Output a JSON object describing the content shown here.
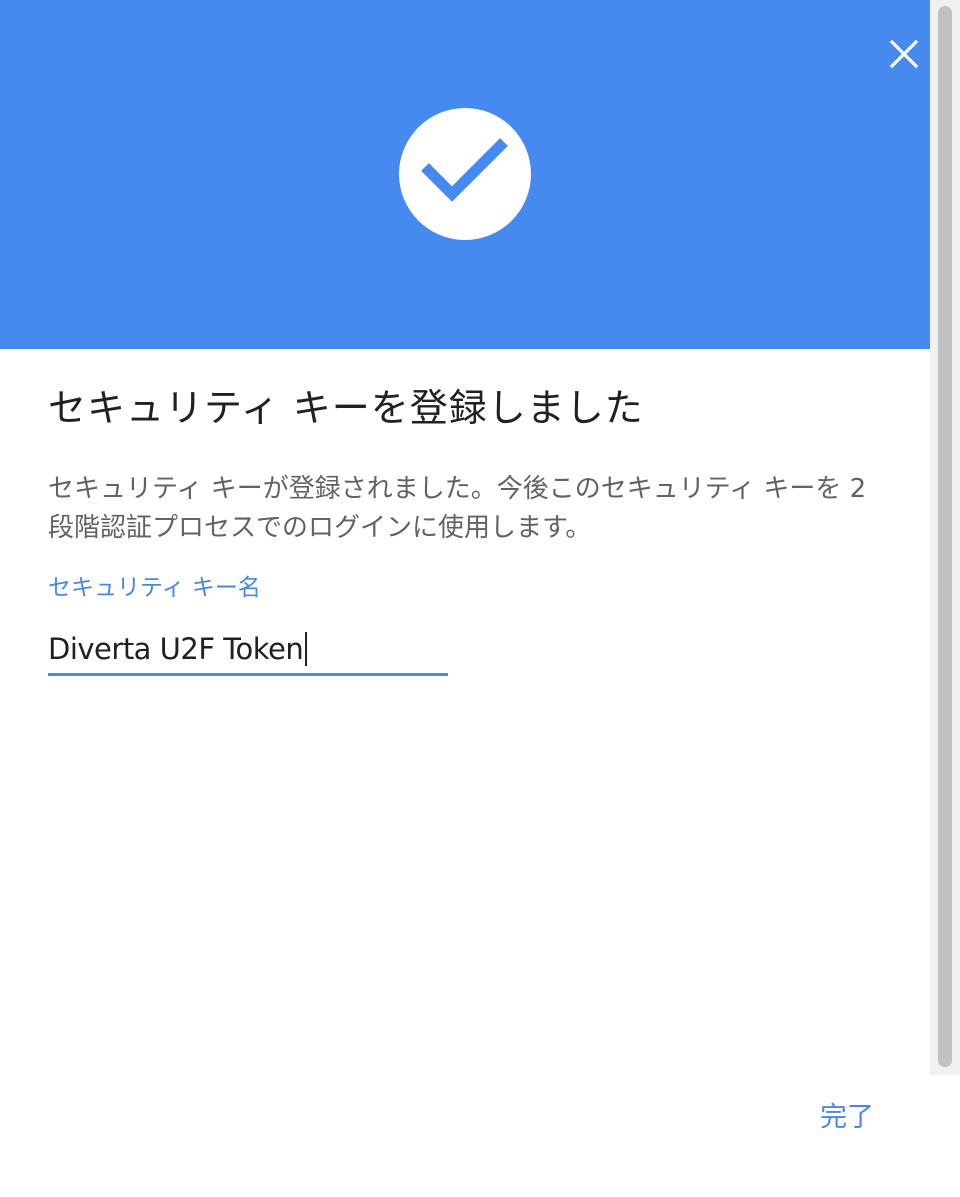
{
  "colors": {
    "accent": "#4689ef",
    "header_bg": "#4689ef",
    "link": "#4a86e8",
    "title_text": "#202124",
    "body_text": "#5f6368",
    "scrollbar_track": "#f1f1f1",
    "scrollbar_thumb": "#c1c1c1"
  },
  "header": {
    "close_icon": "close-icon",
    "status_icon": "checkmark-circle-icon"
  },
  "content": {
    "title": "セキュリティ キーを登録しました",
    "description": "セキュリティ キーが登録されました。今後このセキュリティ キーを 2 段階認証プロセスでのログインに使用します。",
    "field_label": "セキュリティ キー名",
    "field_value": "Diverta U2F Token"
  },
  "footer": {
    "done_label": "完了"
  }
}
